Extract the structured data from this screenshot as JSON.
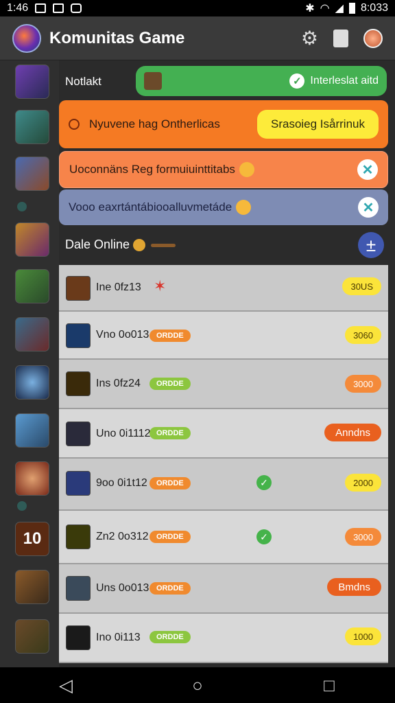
{
  "status_bar": {
    "time": "1:46",
    "clock": "8:033"
  },
  "app": {
    "title": "Komunitas Game"
  },
  "notification": {
    "label": "Notlakt",
    "status": "Interleslat aitd"
  },
  "banners": [
    {
      "text": "Nyuvene hag Ontherlicas",
      "button": "Srasoieg Isårrinuk"
    },
    {
      "text": "Uoconnäns Reg formuiuinttitabs"
    },
    {
      "text": "Vooo eaxrtántábiooalluvmetáde"
    }
  ],
  "online": {
    "title": "Dale Online"
  },
  "items": [
    {
      "name": "Ine 0fz13",
      "tag": "",
      "badge": "30US",
      "check": false
    },
    {
      "name": "Vno 0o013",
      "tag": "ORDDE",
      "badge": "3060",
      "check": false
    },
    {
      "name": "Ins 0fz24",
      "tag": "ORDDE",
      "badge": "3000",
      "check": false
    },
    {
      "name": "Uno 0i1112",
      "tag": "ORDDE",
      "badge": "Anndns",
      "check": false
    },
    {
      "name": "9oo 0i1t12",
      "tag": "ORDDE",
      "badge": "2000",
      "check": true
    },
    {
      "name": "Zn2 0o312",
      "tag": "ORDDE",
      "badge": "3000",
      "check": true
    },
    {
      "name": "Uns 0o013",
      "tag": "ORDDE",
      "badge": "Bmdns",
      "check": false
    },
    {
      "name": "Ino 0i113",
      "tag": "ORDDE",
      "badge": "1000",
      "check": false
    }
  ],
  "sidebar": {
    "badge_number": "10"
  }
}
